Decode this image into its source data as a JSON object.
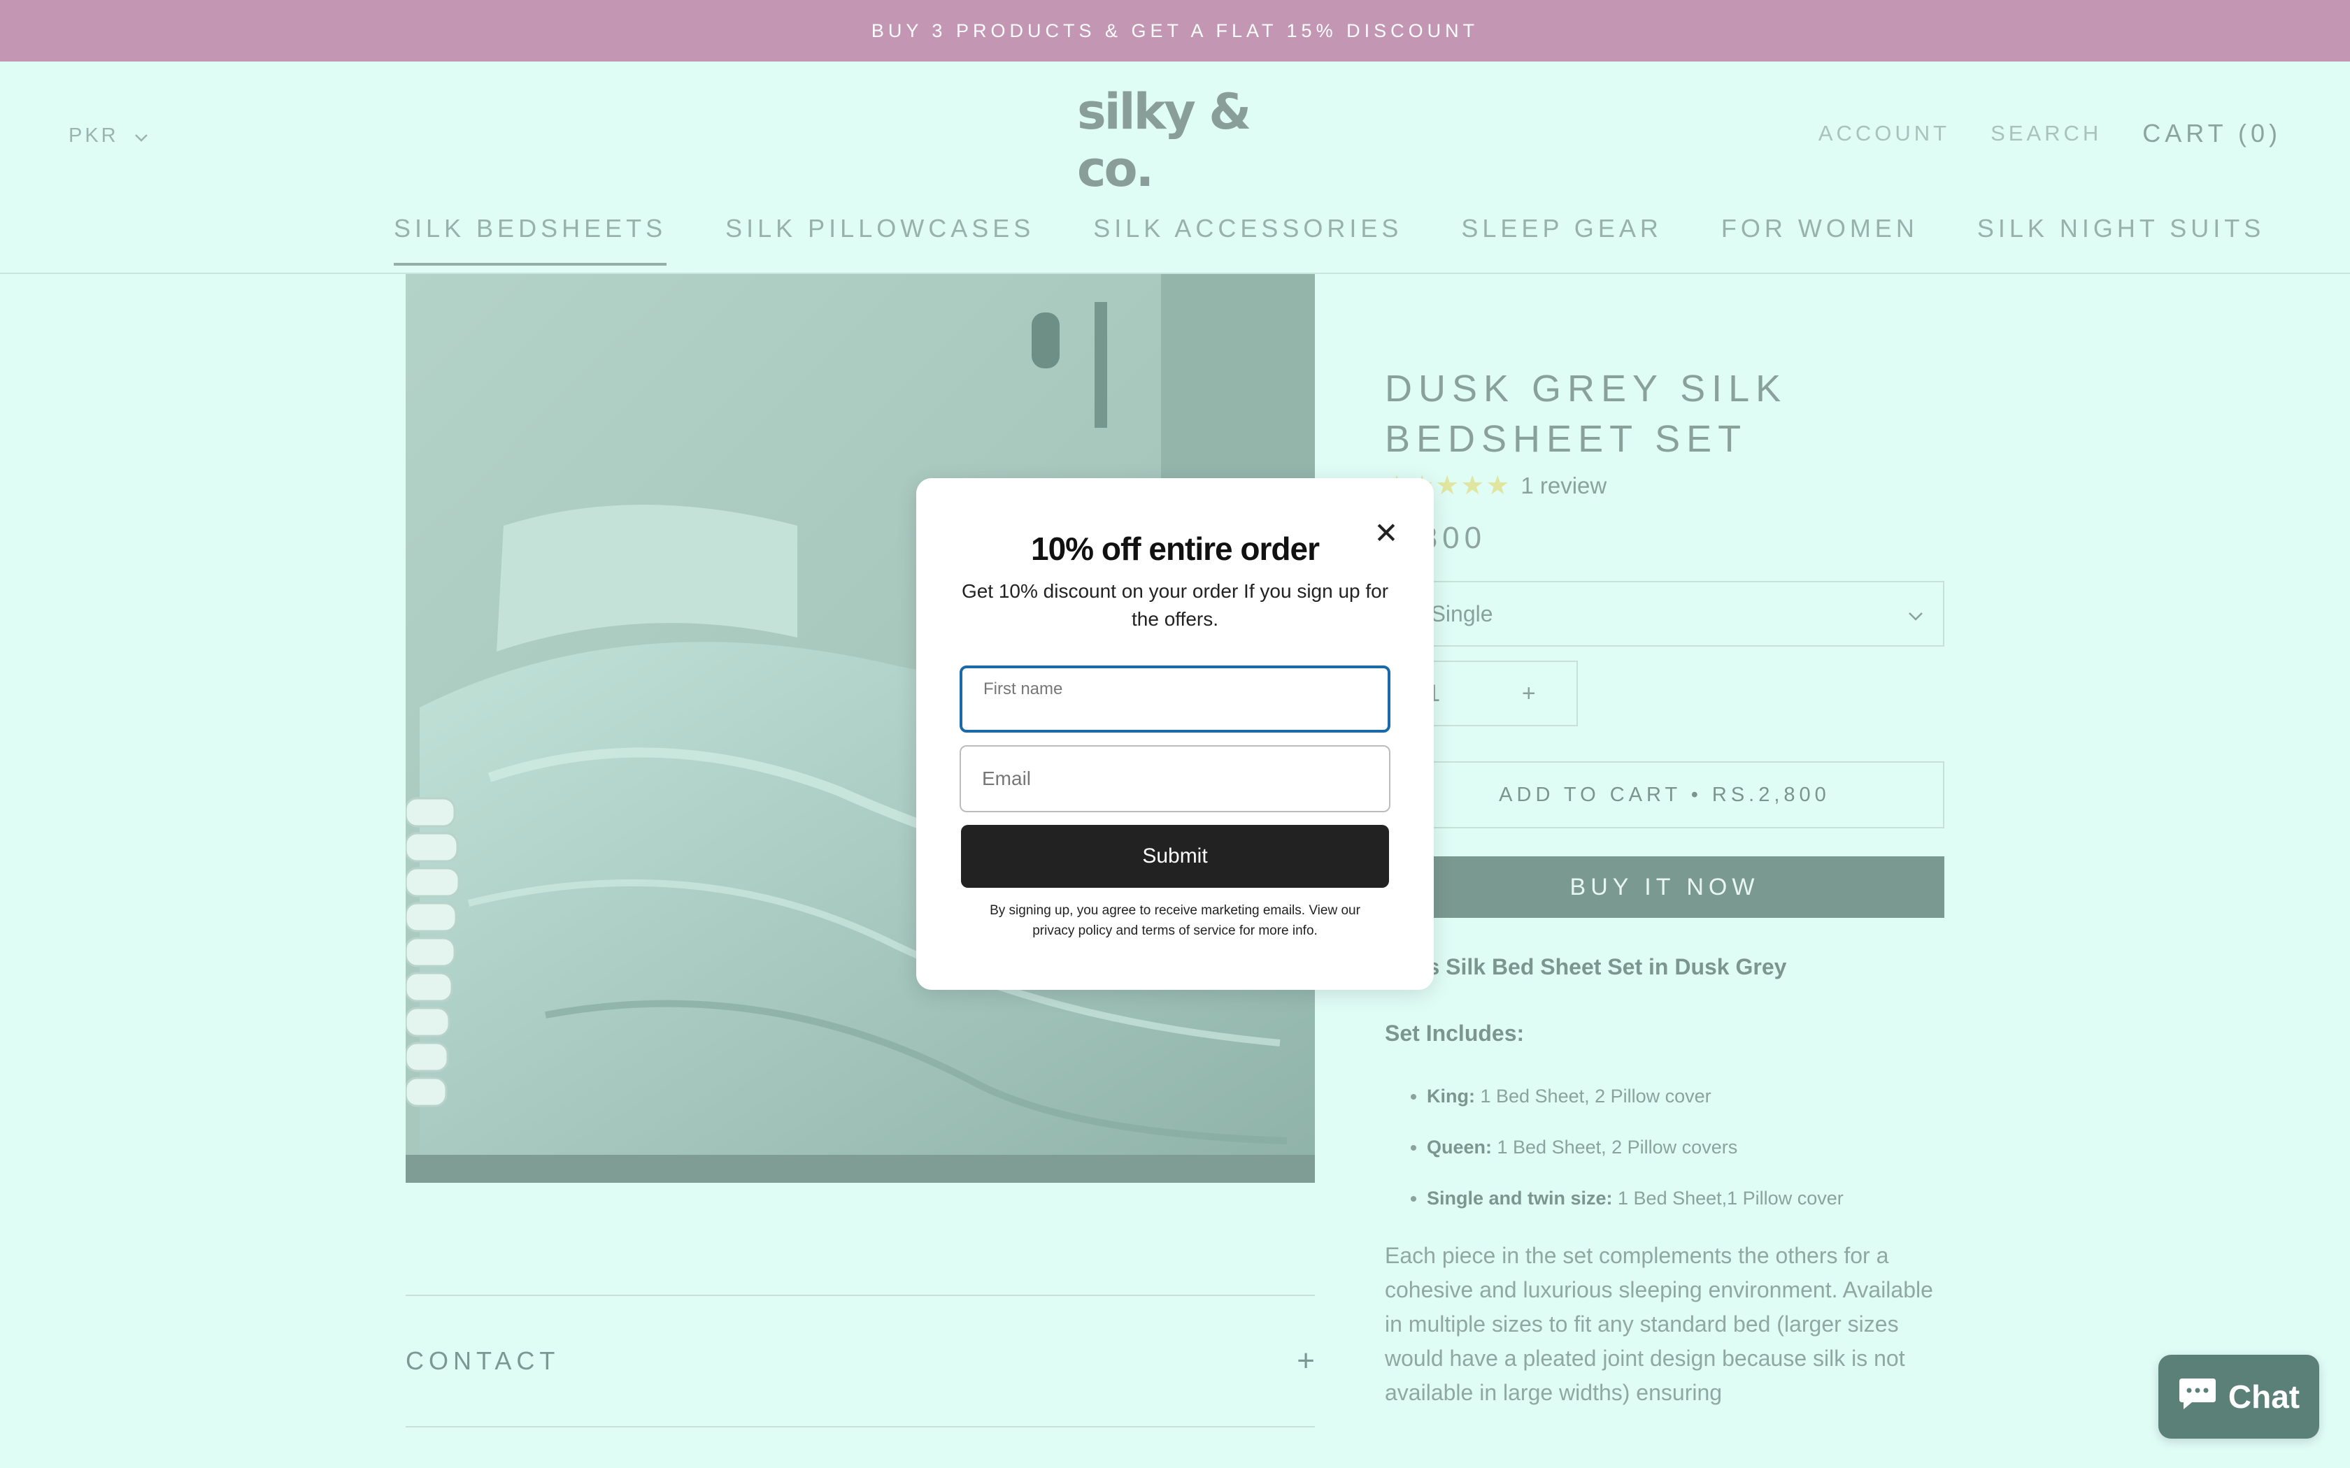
{
  "announcement": {
    "text": "BUY 3 PRODUCTS & GET A FLAT 15% DISCOUNT"
  },
  "header": {
    "currency": "PKR",
    "logo": "silky & co.",
    "account": "ACCOUNT",
    "search": "SEARCH",
    "cart": "CART (0)"
  },
  "nav": {
    "items": [
      {
        "label": "SILK BEDSHEETS"
      },
      {
        "label": "SILK PILLOWCASES"
      },
      {
        "label": "SILK ACCESSORIES"
      },
      {
        "label": "SLEEP GEAR"
      },
      {
        "label": "FOR WOMEN"
      },
      {
        "label": "SILK NIGHT SUITS"
      }
    ]
  },
  "product": {
    "title": "DUSK GREY SILK BEDSHEET SET",
    "stars": "★★★★★",
    "reviews": "1 review",
    "price": "2,800",
    "size_select": "e: Single",
    "qty_value": "1",
    "qty_plus": "+",
    "add_to_cart": "ADD TO CART  •  RS.2,800",
    "buy_now": "BUY IT NOW",
    "desc_heading": "rious Silk Bed Sheet Set in Dusk Grey",
    "set_includes": "Set Includes:",
    "bullets": [
      {
        "key": "King:",
        "value": " 1 Bed Sheet, 2 Pillow cover"
      },
      {
        "key": "Queen:",
        "value": " 1 Bed Sheet, 2 Pillow covers"
      },
      {
        "key": "Single and twin size:",
        "value": " 1 Bed Sheet,1 Pillow cover"
      }
    ],
    "paragraph": "Each piece in the set complements the others for a cohesive and luxurious sleeping environment. Available in multiple sizes to fit any standard bed (larger sizes would have a pleated joint design because silk is not available in large widths) ensuring"
  },
  "accordion": {
    "contact": "CONTACT",
    "plus": "+"
  },
  "modal": {
    "title": "10% off entire order",
    "subtitle": "Get 10% discount on your order If you sign up for the offers.",
    "first_name_label": "First name",
    "email_placeholder": "Email",
    "submit": "Submit",
    "legal": "By signing up, you agree to receive marketing emails. View our privacy policy and terms of service for more info.",
    "close": "✕"
  },
  "chat": {
    "label": "Chat"
  }
}
